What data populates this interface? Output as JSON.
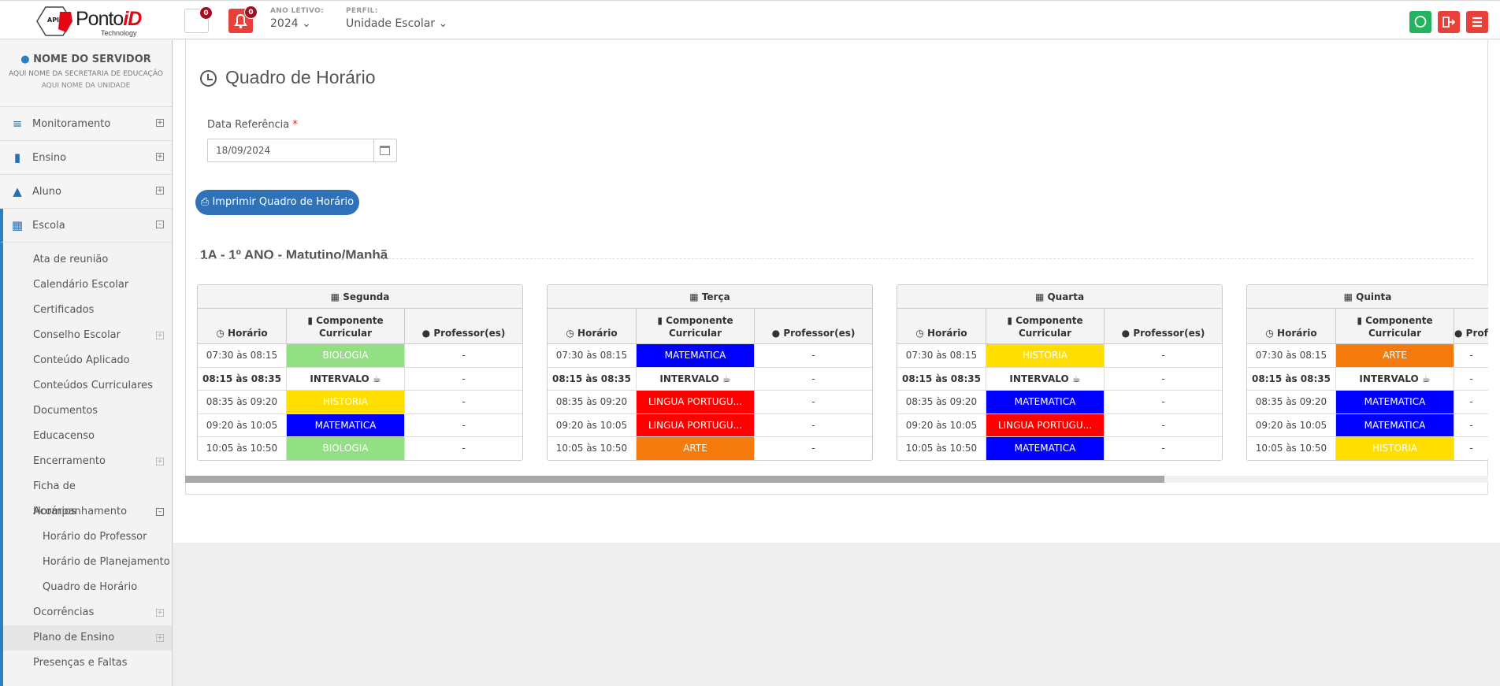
{
  "logo": {
    "brand_a": "Ponto",
    "brand_b": "iD",
    "sub": "Technology",
    "badge": "API"
  },
  "topbar": {
    "messages_count": "0",
    "notifications_count": "0",
    "ano_label": "ANO LETIVO:",
    "ano_value": "2024 ⌄",
    "perfil_label": "PERFIL:",
    "perfil_value": "Unidade Escolar ⌄"
  },
  "user": {
    "name": "NOME DO SERVIDOR",
    "secretaria": "AQUI NOME DA SECRETARIA DE EDUCAÇÃO",
    "unidade": "AQUI NOME DA UNIDADE"
  },
  "nav": {
    "monitoramento": "Monitoramento",
    "ensino": "Ensino",
    "aluno": "Aluno",
    "escola": "Escola"
  },
  "escola_items": [
    "Ata de reunião",
    "Calendário Escolar",
    "Certificados",
    "Conselho Escolar",
    "Conteúdo Aplicado",
    "Conteúdos Curriculares",
    "Documentos",
    "Educacenso",
    "Encerramento",
    "Ficha de Acompanhamento",
    "Horários",
    "Horário do Professor",
    "Horário de Planejamento",
    "Quadro de Horário",
    "Ocorrências",
    "Plano de Ensino",
    "Presenças e Faltas"
  ],
  "page": {
    "title": "Quadro de Horário",
    "date_label": "Data Referência",
    "date_required": "*",
    "date_value": "18/09/2024",
    "print_button": "Imprimir Quadro de Horário",
    "class_title": "1A - 1º ANO - Matutino/Manhã"
  },
  "table_headers": {
    "horario": "Horário",
    "componente_a": "Componente",
    "componente_b": "Curricular",
    "professor": "Professor(es)"
  },
  "colors": {
    "BIOLOGIA": "#92df84",
    "HISTORIA": "#ffde00",
    "MATEMATICA": "#0000ff",
    "LINGUA": "#ff0000",
    "ARTE": "#f47b0c"
  },
  "days": [
    {
      "name": "Segunda",
      "rows": [
        {
          "time": "07:30 às 08:15",
          "subject": "BIOLOGIA",
          "prof": "-"
        },
        {
          "time": "08:15 às 08:35",
          "subject": "INTERVALO ☕",
          "prof": "-"
        },
        {
          "time": "08:35 às 09:20",
          "subject": "HISTORIA",
          "prof": "-"
        },
        {
          "time": "09:20 às 10:05",
          "subject": "MATEMATICA",
          "prof": "-"
        },
        {
          "time": "10:05 às 10:50",
          "subject": "BIOLOGIA",
          "prof": "-"
        }
      ]
    },
    {
      "name": "Terça",
      "rows": [
        {
          "time": "07:30 às 08:15",
          "subject": "MATEMATICA",
          "prof": "-"
        },
        {
          "time": "08:15 às 08:35",
          "subject": "INTERVALO ☕",
          "prof": "-"
        },
        {
          "time": "08:35 às 09:20",
          "subject": "LINGUA PORTUGU...",
          "prof": "-"
        },
        {
          "time": "09:20 às 10:05",
          "subject": "LINGUA PORTUGU...",
          "prof": "-"
        },
        {
          "time": "10:05 às 10:50",
          "subject": "ARTE",
          "prof": "-"
        }
      ]
    },
    {
      "name": "Quarta",
      "rows": [
        {
          "time": "07:30 às 08:15",
          "subject": "HISTORIA",
          "prof": "-"
        },
        {
          "time": "08:15 às 08:35",
          "subject": "INTERVALO ☕",
          "prof": "-"
        },
        {
          "time": "08:35 às 09:20",
          "subject": "MATEMATICA",
          "prof": "-"
        },
        {
          "time": "09:20 às 10:05",
          "subject": "LINGUA PORTUGU...",
          "prof": "-"
        },
        {
          "time": "10:05 às 10:50",
          "subject": "MATEMATICA",
          "prof": "-"
        }
      ]
    },
    {
      "name": "Quinta",
      "rows": [
        {
          "time": "07:30 às 08:15",
          "subject": "ARTE",
          "prof": "-"
        },
        {
          "time": "08:15 às 08:35",
          "subject": "INTERVALO ☕",
          "prof": "-"
        },
        {
          "time": "08:35 às 09:20",
          "subject": "MATEMATICA",
          "prof": "-"
        },
        {
          "time": "09:20 às 10:05",
          "subject": "MATEMATICA",
          "prof": "-"
        },
        {
          "time": "10:05 às 10:50",
          "subject": "HISTORIA",
          "prof": "-"
        }
      ]
    }
  ]
}
